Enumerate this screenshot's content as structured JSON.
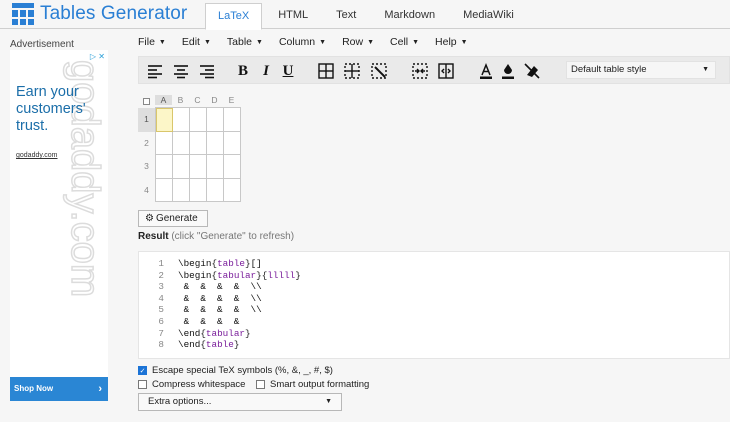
{
  "header": {
    "logo_text": "Tables Generator",
    "tabs": [
      {
        "label": "LaTeX",
        "active": true
      },
      {
        "label": "HTML"
      },
      {
        "label": "Text"
      },
      {
        "label": "Markdown"
      },
      {
        "label": "MediaWiki"
      }
    ]
  },
  "ad": {
    "label": "Advertisement",
    "headline": "Earn your customers' trust.",
    "url": "godaddy.com",
    "cta": "Shop Now",
    "watermark": "godaddy.com"
  },
  "menu": [
    "File",
    "Edit",
    "Table",
    "Column",
    "Row",
    "Cell",
    "Help"
  ],
  "toolbar": {
    "style_select": "Default table style",
    "bold": "B",
    "italic": "I",
    "underline": "U"
  },
  "grid": {
    "columns": [
      "A",
      "B",
      "C",
      "D",
      "E"
    ],
    "rows": [
      "1",
      "2",
      "3",
      "4"
    ]
  },
  "generate_label": "Generate",
  "result": {
    "label": "Result",
    "hint": "(click \"Generate\" to refresh)"
  },
  "code_lines": [
    {
      "n": "1",
      "text": "\\begin{table}[]"
    },
    {
      "n": "2",
      "text": "\\begin{tabular}{lllll}"
    },
    {
      "n": "3",
      "text": " &  &  &  &  \\\\"
    },
    {
      "n": "4",
      "text": " &  &  &  &  \\\\"
    },
    {
      "n": "5",
      "text": " &  &  &  &  \\\\"
    },
    {
      "n": "6",
      "text": " &  &  &  &"
    },
    {
      "n": "7",
      "text": "\\end{tabular}"
    },
    {
      "n": "8",
      "text": "\\end{table}"
    }
  ],
  "options": {
    "escape": "Escape special TeX symbols (%, &, _, #, $)",
    "escape_checked": true,
    "compress": "Compress whitespace",
    "compress_checked": false,
    "smart": "Smart output formatting",
    "smart_checked": false,
    "extra": "Extra options..."
  },
  "colors": {
    "accent": "#2a7fd4",
    "keyword": "#7a1e9b",
    "selected_cell": "#fcf6c8"
  }
}
